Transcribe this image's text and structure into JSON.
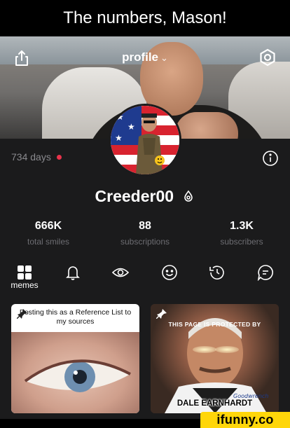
{
  "caption": "The numbers, Mason!",
  "header": {
    "title": "profile",
    "title_chevron": "⌄",
    "share_icon": "share-icon",
    "settings_icon": "hexagon-settings-icon"
  },
  "profile": {
    "days": "734 days",
    "username": "Creeder00",
    "verified_icon": "drop-badge-icon",
    "stats": [
      {
        "value": "666K",
        "label": "total smiles"
      },
      {
        "value": "88",
        "label": "subscriptions"
      },
      {
        "value": "1.3K",
        "label": "subscribers"
      }
    ]
  },
  "tabs": [
    {
      "name": "memes",
      "label": "memes",
      "icon": "grid-icon"
    },
    {
      "name": "notifications",
      "icon": "bell-icon"
    },
    {
      "name": "views",
      "icon": "eye-icon"
    },
    {
      "name": "smiles",
      "icon": "smiley-icon"
    },
    {
      "name": "history",
      "icon": "history-icon"
    },
    {
      "name": "comments",
      "icon": "comment-icon"
    }
  ],
  "posts": [
    {
      "caption": "Posting this as a Reference List to my sources"
    },
    {
      "banner": "THIS PAGE IS PROTECTED BY",
      "name": "DALE EARNHARDT"
    }
  ],
  "watermark": "ifunny.co",
  "colors": {
    "background": "#1b1b1c",
    "accent_dot": "#e9334b",
    "muted_text": "#6d6d72",
    "watermark_bg": "#ffd60a"
  }
}
